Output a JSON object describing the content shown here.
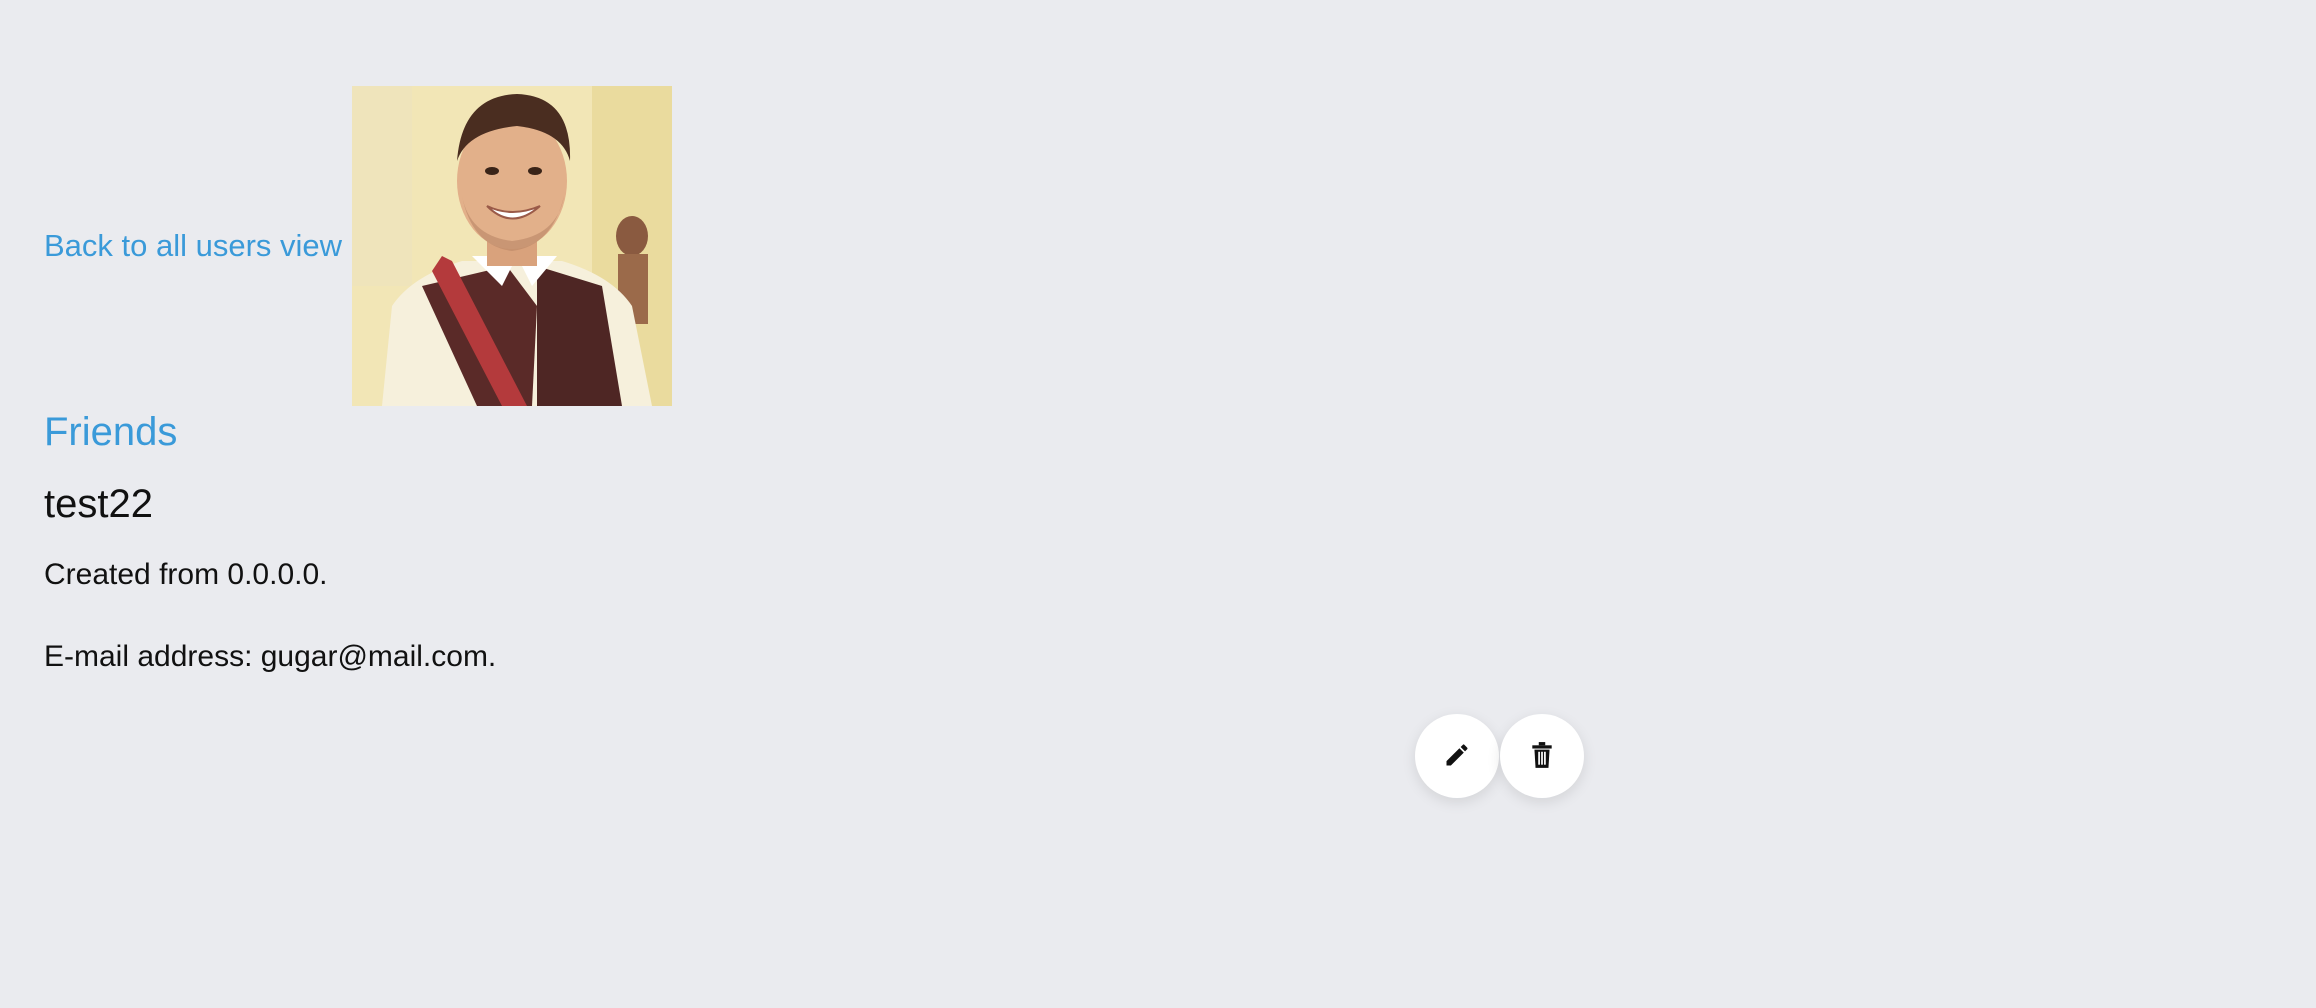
{
  "nav": {
    "back_label": "Back to all users view",
    "friends_label": "Friends"
  },
  "user": {
    "username": "test22",
    "created_text": "Created from 0.0.0.0.",
    "email_text": "E-mail address: gugar@mail.com."
  },
  "avatar": {
    "icon": "profile-photo"
  },
  "actions": {
    "edit_icon": "pencil-icon",
    "delete_icon": "trash-icon"
  },
  "colors": {
    "background": "#eaebef",
    "link": "#3a9ad9",
    "button_bg": "#ffffff"
  }
}
